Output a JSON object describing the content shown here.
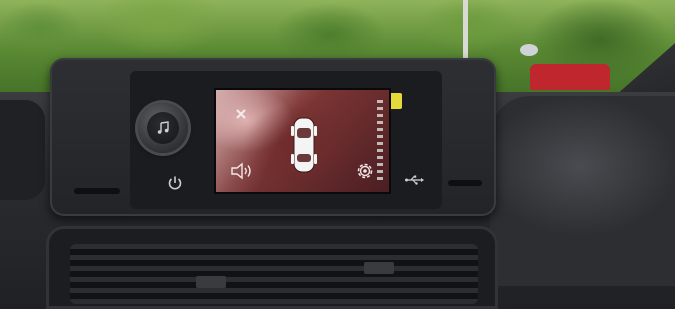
{
  "scene": {
    "description_icons": [
      "close-icon",
      "car-top-view-icon",
      "speaker-icon",
      "gear-icon",
      "music-note-icon",
      "power-icon",
      "usb-icon"
    ]
  },
  "screen": {
    "close_glyph": "×",
    "accent_color": "#7b3434"
  },
  "colors": {
    "tag_yellow": "#e6d93a",
    "dashboard": "#2b2c30"
  }
}
